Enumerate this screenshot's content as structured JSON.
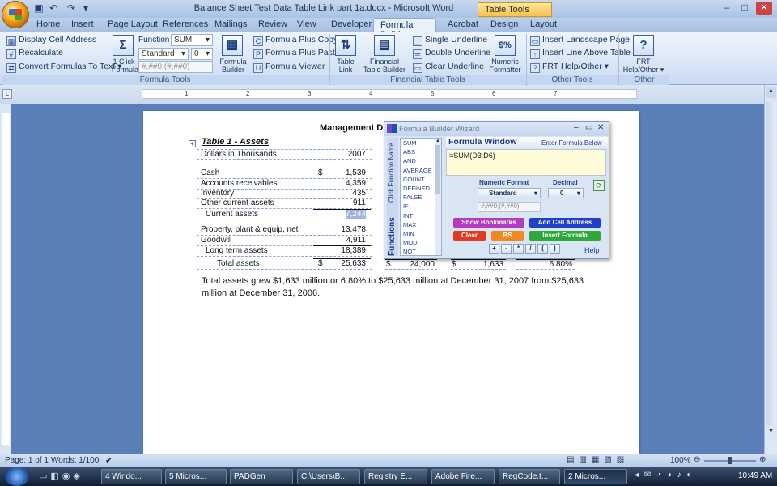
{
  "window": {
    "title": "Balance Sheet Test Data Table Link part 1a.docx - Microsoft Word",
    "context_tab": "Table Tools",
    "controls": {
      "minimize": "–",
      "maximize": "□",
      "close": "✕"
    }
  },
  "tabs": [
    "Home",
    "Insert",
    "Page Layout",
    "References",
    "Mailings",
    "Review",
    "View",
    "Developer",
    "Formula Builder",
    "Acrobat",
    "Design",
    "Layout"
  ],
  "ribbon": {
    "formula_tools": {
      "display_cell_address": "Display Cell Address",
      "recalculate": "Recalculate",
      "convert_formulas": "Convert Formulas To Text",
      "one_click": "1 Click",
      "one_click2": "Formula",
      "function_lbl": "Function",
      "function_val": "SUM",
      "format_val": "Standard",
      "decimal_val": "0",
      "mask": "#,##0;(#,##0)",
      "formula_builder": "Formula",
      "formula_builder2": "Builder",
      "plus_copy": "Formula Plus Copy",
      "plus_paste": "Formula Plus Paste",
      "viewer": "Formula Viewer",
      "label": "Formula Tools"
    },
    "financial": {
      "table_link": "Table",
      "table_link2": "Link",
      "fin_builder": "Financial",
      "fin_builder2": "Table Builder",
      "single": "Single Underline",
      "double": "Double Underline",
      "clear": "Clear Underline",
      "num_fmt": "Numeric",
      "num_fmt2": "Formatter",
      "label": "Financial Table Tools"
    },
    "other": {
      "landscape": "Insert Landscape Page",
      "line_above": "Insert Line Above Table",
      "frt_help": "FRT Help/Other",
      "label": "Other Tools",
      "frt": "FRT",
      "frt2": "Help/Other",
      "other_label": "Other"
    }
  },
  "ruler": [
    "1",
    "2",
    "3",
    "4",
    "5",
    "6",
    "7"
  ],
  "document": {
    "heading": "Management Dis",
    "table_title": "Table 1 - Assets",
    "rows": [
      {
        "label": "Dollars in Thousands",
        "dollar": "",
        "value": "2007"
      },
      {
        "label": "Cash",
        "dollar": "$",
        "value": "1,539"
      },
      {
        "label": "Accounts receivables",
        "dollar": "",
        "value": "4,359"
      },
      {
        "label": "Inventory",
        "dollar": "",
        "value": "435"
      },
      {
        "label": "Other current assets",
        "dollar": "",
        "value": "911"
      },
      {
        "label": "Current assets",
        "dollar": "",
        "value": "7,244"
      },
      {
        "label": "Property, plant & equip, net",
        "dollar": "",
        "value": "13,478"
      },
      {
        "label": "Goodwill",
        "dollar": "",
        "value": "4,911"
      },
      {
        "label": "Long term assets",
        "dollar": "",
        "value": "18,389"
      },
      {
        "label": "Total assets",
        "dollar": "$",
        "value": "25,633"
      }
    ],
    "total_extra": [
      {
        "dollar": "$",
        "value": "24,000"
      },
      {
        "dollar": "$",
        "value": "1,633"
      },
      {
        "dollar": "",
        "value": "6.80%"
      }
    ],
    "paragraph_line1": "Total assets grew $1,633  million or 6.80%  to $25,633  million at December 31, 2007  from $25,633",
    "paragraph_line2": "million at December 31, 2006."
  },
  "wizard": {
    "title": "Formula Builder Wizard",
    "side_label": "Click Function Name",
    "functions_label": "Functions",
    "functions": [
      "SUM",
      "ABS",
      "AND",
      "AVERAGE",
      "COUNT",
      "DEFINED",
      "FALSE",
      "IF",
      "INT",
      "MAX",
      "MIN",
      "MOD",
      "NOT"
    ],
    "window_title": "Formula Window",
    "enter_hint": "Enter Formula Below",
    "formula": "=SUM(D3:D6)",
    "numeric_format_lbl": "Numeric Format",
    "decimal_lbl": "Decimal",
    "format_val": "Standard",
    "decimal_val": "0",
    "mask": "#,##0;(#,##0)",
    "show_bookmarks": "Show Bookmarks",
    "add_cell": "Add Cell Address",
    "clear": "Clear",
    "bs": "BS",
    "insert_formula": "Insert Formula",
    "ops": [
      "+",
      "-",
      "*",
      "/",
      "(",
      ")"
    ],
    "help": "Help"
  },
  "status": {
    "page": "Page: 1 of 1",
    "words": "Words: 1/100",
    "zoom": "100%"
  },
  "taskbar": {
    "items": [
      "4 Windo...",
      "5 Micros...",
      "PADGen",
      "C:\\Users\\B...",
      "Registry E...",
      "Adobe Fire...",
      "RegCode.t...",
      "2 Micros..."
    ],
    "clock": "10:49 AM"
  },
  "colors": {
    "ribbon_bg": "#dae6f6",
    "accent": "#f6c24a",
    "bookmark_btn": "#b23cc0",
    "add_cell_btn": "#2040c8",
    "clear_btn": "#e03a22",
    "bs_btn": "#f08a20",
    "insert_btn": "#2ea83a"
  }
}
